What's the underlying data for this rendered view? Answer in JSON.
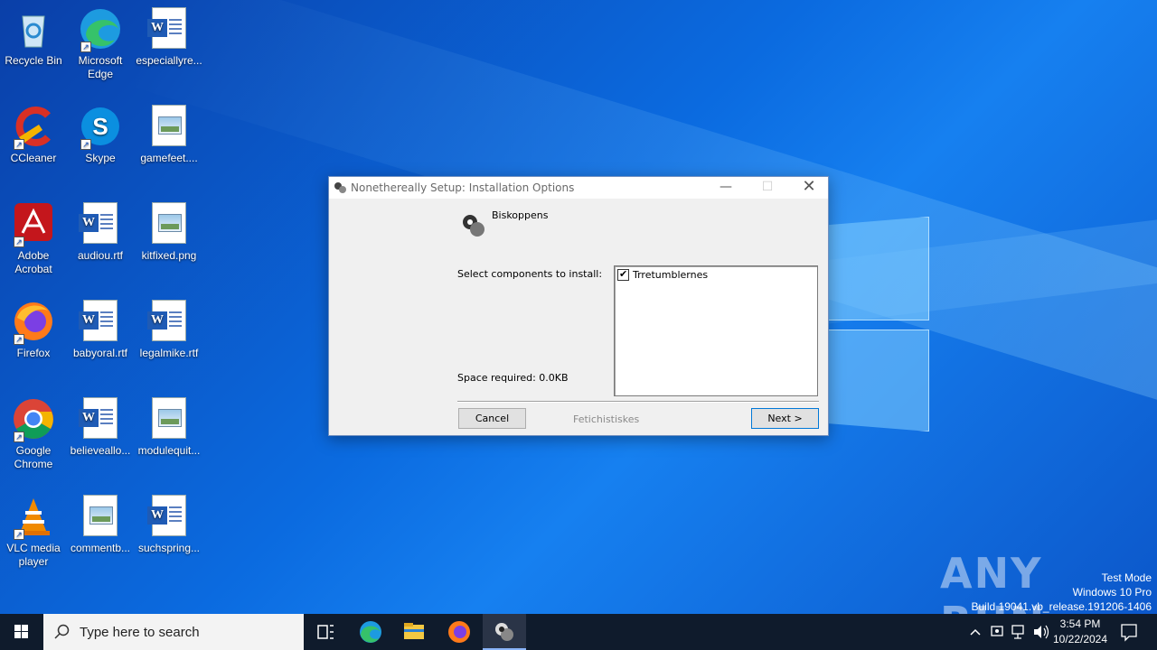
{
  "desktop_icons": [
    {
      "label": "Recycle Bin",
      "icon": "recycle-bin-icon"
    },
    {
      "label": "Microsoft Edge",
      "icon": "edge-icon"
    },
    {
      "label": "especiallyre...",
      "icon": "word-document-icon"
    },
    {
      "label": "CCleaner",
      "icon": "ccleaner-icon"
    },
    {
      "label": "Skype",
      "icon": "skype-icon"
    },
    {
      "label": "gamefeet....",
      "icon": "image-file-icon"
    },
    {
      "label": "Adobe Acrobat",
      "icon": "adobe-acrobat-icon"
    },
    {
      "label": "audiou.rtf",
      "icon": "word-document-icon"
    },
    {
      "label": "kitfixed.png",
      "icon": "image-file-icon"
    },
    {
      "label": "Firefox",
      "icon": "firefox-icon"
    },
    {
      "label": "babyoral.rtf",
      "icon": "word-document-icon"
    },
    {
      "label": "legalmike.rtf",
      "icon": "word-document-icon"
    },
    {
      "label": "Google Chrome",
      "icon": "chrome-icon"
    },
    {
      "label": "believeallo...",
      "icon": "word-document-icon"
    },
    {
      "label": "modulequit...",
      "icon": "image-file-icon"
    },
    {
      "label": "VLC media player",
      "icon": "vlc-icon"
    },
    {
      "label": "commentb...",
      "icon": "image-file-icon"
    },
    {
      "label": "suchspring...",
      "icon": "word-document-icon"
    }
  ],
  "dialog": {
    "title": "Nonethereally Setup: Installation Options",
    "header": "Biskoppens",
    "select_label": "Select components to install:",
    "components": [
      {
        "label": "Trretumblernes",
        "checked": true
      }
    ],
    "space_required": "Space required: 0.0KB",
    "cancel_label": "Cancel",
    "brand": "Fetichistiskes",
    "next_label": "Next >"
  },
  "watermark": {
    "brand": "ANY RUN",
    "line1": "Test Mode",
    "line2": "Windows 10 Pro",
    "line3": "Build 19041.vb_release.191206-1406"
  },
  "taskbar": {
    "search_placeholder": "Type here to search",
    "time": "3:54 PM",
    "date": "10/22/2024"
  }
}
